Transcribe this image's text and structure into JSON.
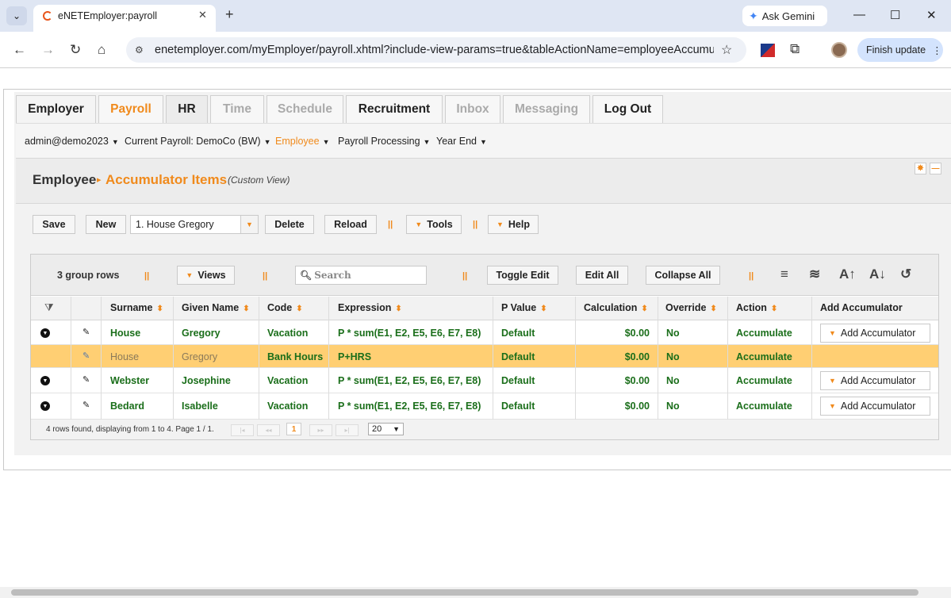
{
  "browser": {
    "tab_title": "eNETEmployer:payroll",
    "url": "enetemployer.com/myEmployer/payroll.xhtml?include-view-params=true&tableActionName=employeeAccumu...",
    "gemini_label": "Ask Gemini",
    "finish_update_label": "Finish update"
  },
  "main_tabs": [
    {
      "label": "Employer"
    },
    {
      "label": "Payroll"
    },
    {
      "label": "HR"
    },
    {
      "label": "Time"
    },
    {
      "label": "Schedule"
    },
    {
      "label": "Recruitment"
    },
    {
      "label": "Inbox"
    },
    {
      "label": "Messaging"
    },
    {
      "label": "Log Out"
    }
  ],
  "submenu": {
    "user": "admin@demo2023",
    "current_payroll": "Current Payroll: DemoCo (BW)",
    "employee": "Employee",
    "payroll_processing": "Payroll Processing",
    "year_end": "Year End"
  },
  "breadcrumb": {
    "section": "Employee",
    "page": "Accumulator Items",
    "view": "(Custom View)"
  },
  "actions": {
    "save": "Save",
    "new": "New",
    "employee_select": "1. House Gregory",
    "delete": "Delete",
    "reload": "Reload",
    "tools": "Tools",
    "help": "Help"
  },
  "grid_toolbar": {
    "group_rows": "3 group rows",
    "views": "Views",
    "search_placeholder": "Search",
    "toggle_edit": "Toggle Edit",
    "edit_all": "Edit All",
    "collapse_all": "Collapse All"
  },
  "columns": [
    "Surname",
    "Given Name",
    "Code",
    "Expression",
    "P Value",
    "Calculation",
    "Override",
    "Action",
    "Add Accumulator"
  ],
  "rows": [
    {
      "surname": "House",
      "given": "Gregory",
      "code": "Vacation",
      "expression": "P * sum(E1, E2, E5, E6, E7, E8)",
      "pvalue": "Default",
      "calculation": "$0.00",
      "override": "No",
      "action": "Accumulate",
      "add": "Add Accumulator"
    },
    {
      "surname": "House",
      "given": "Gregory",
      "code": "Bank Hours",
      "expression": "P+HRS",
      "pvalue": "Default",
      "calculation": "$0.00",
      "override": "No",
      "action": "Accumulate",
      "add": ""
    },
    {
      "surname": "Webster",
      "given": "Josephine",
      "code": "Vacation",
      "expression": "P * sum(E1, E2, E5, E6, E7, E8)",
      "pvalue": "Default",
      "calculation": "$0.00",
      "override": "No",
      "action": "Accumulate",
      "add": "Add Accumulator"
    },
    {
      "surname": "Bedard",
      "given": "Isabelle",
      "code": "Vacation",
      "expression": "P * sum(E1, E2, E5, E6, E7, E8)",
      "pvalue": "Default",
      "calculation": "$0.00",
      "override": "No",
      "action": "Accumulate",
      "add": "Add Accumulator"
    }
  ],
  "footer": {
    "status": "4 rows found, displaying from 1 to 4. Page 1 / 1.",
    "current_page": "1",
    "page_size": "20"
  }
}
